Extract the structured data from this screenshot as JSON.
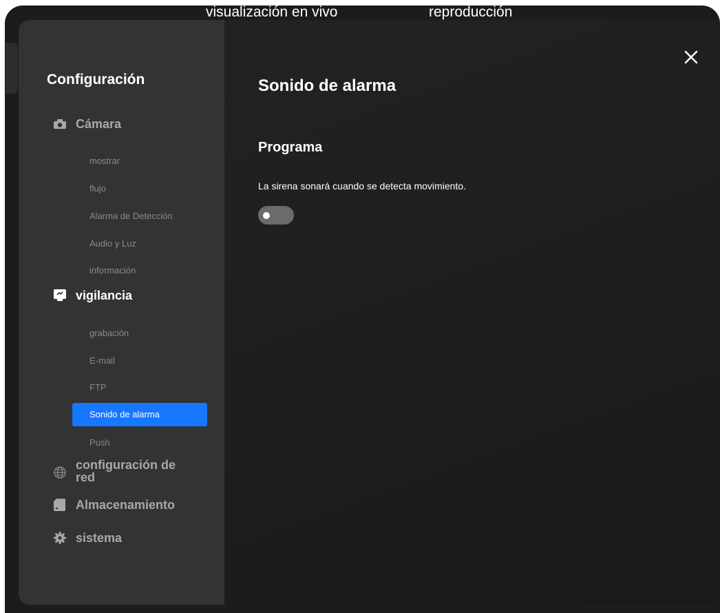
{
  "top_tabs": {
    "live": "visualización en vivo",
    "playback": "reproducción"
  },
  "sidebar": {
    "title": "Configuración",
    "camera": {
      "label": "Cámara",
      "icon": "camera-icon",
      "items": [
        "mostrar",
        "flujo",
        "Alarma de Detección",
        "Audio y Luz",
        "información"
      ]
    },
    "surveillance": {
      "label": "vigilancia",
      "icon": "monitor-icon",
      "items": [
        "grabación",
        "E-mail",
        "FTP",
        "Sonido de alarma",
        "Push"
      ],
      "selected": "Sonido de alarma"
    },
    "network": {
      "label_line1": "configuración de",
      "label_line2": "red",
      "icon": "globe-icon"
    },
    "storage": {
      "label": "Almacenamiento",
      "icon": "sd-card-icon"
    },
    "system": {
      "label": "sistema",
      "icon": "gear-icon"
    }
  },
  "main": {
    "title": "Sonido de alarma",
    "section_title": "Programa",
    "description": "La sirena sonará cuando se detecta movimiento.",
    "toggle_on": false
  },
  "colors": {
    "accent": "#1677ff",
    "sidebar_bg": "#333333",
    "dialog_bg": "#1f1f1f"
  }
}
